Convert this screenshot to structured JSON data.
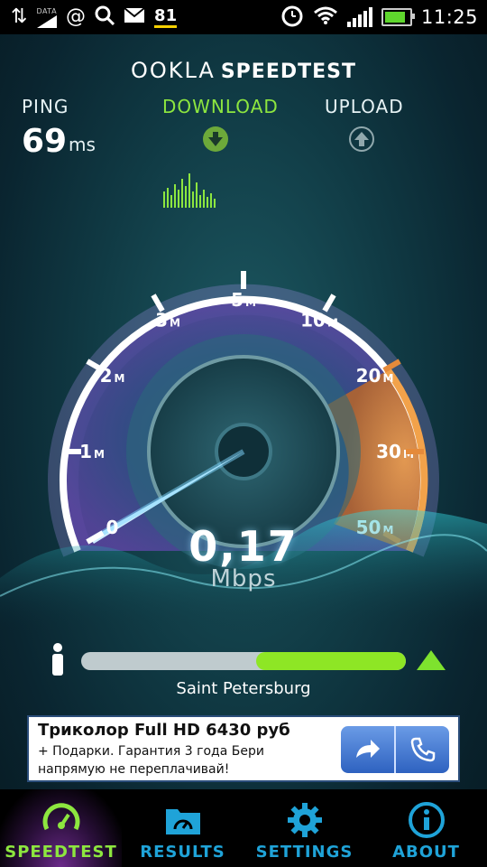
{
  "statusbar": {
    "data_label": "DATA",
    "time": "11:25",
    "network_digits": "81",
    "icons": [
      "sync-icon",
      "data-icon",
      "at-icon",
      "search-icon",
      "gmail-icon",
      "network-digits-icon",
      "alarm-icon",
      "wifi-icon",
      "signal-icon",
      "battery-icon"
    ]
  },
  "brand": {
    "ookla": "OOKLA",
    "speedtest": "SPEEDTEST"
  },
  "metrics": {
    "ping_label": "PING",
    "ping_value": "69",
    "ping_unit": "ms",
    "download_label": "DOWNLOAD",
    "upload_label": "UPLOAD"
  },
  "gauge": {
    "ticks": [
      "0",
      "1M",
      "2M",
      "3M",
      "5M",
      "10M",
      "20M",
      "30M",
      "50M"
    ],
    "reading": "0,17",
    "unit": "Mbps",
    "accent": "#8de63f"
  },
  "progress": {
    "fraction": 0.58,
    "start_fraction": 0.54,
    "server": "Saint Petersburg"
  },
  "ad": {
    "title": "Триколор Full HD 6430 руб",
    "line1": "+ Подарки. Гарантия 3 года Бери",
    "line2": "напрямую не переплачивай!",
    "icons": [
      "share-arrow-icon",
      "phone-icon"
    ]
  },
  "nav": {
    "items": [
      {
        "label": "SPEEDTEST",
        "icon": "speedometer-icon",
        "active": true
      },
      {
        "label": "RESULTS",
        "icon": "folder-icon",
        "active": false
      },
      {
        "label": "SETTINGS",
        "icon": "gear-icon",
        "active": false
      },
      {
        "label": "ABOUT",
        "icon": "info-icon",
        "active": false
      }
    ]
  },
  "colors": {
    "download_green": "#8de63f",
    "nav_blue": "#1fa3d8",
    "gauge_orange": "#e58a3a"
  }
}
